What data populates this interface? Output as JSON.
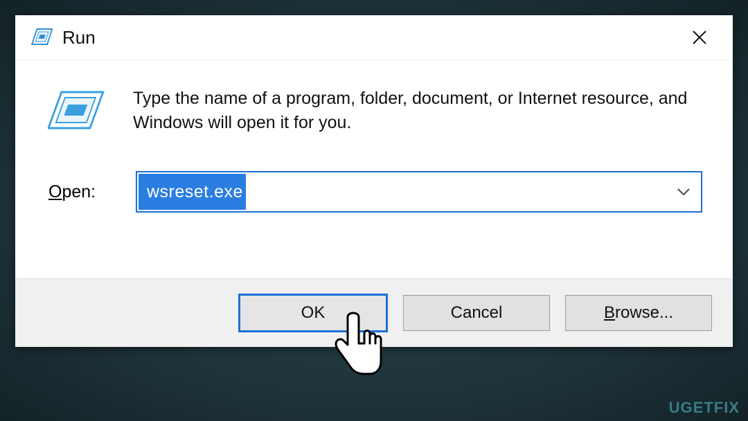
{
  "titlebar": {
    "title": "Run",
    "icon": "run-icon",
    "close_tooltip": "Close"
  },
  "body": {
    "run_glyph": "run-dialog-icon",
    "info_text": "Type the name of a program, folder, document, or Internet resource, and Windows will open it for you.",
    "open_label_pre": "O",
    "open_label_rest": "pen:",
    "input_value": "wsreset.exe"
  },
  "buttons": {
    "ok": "OK",
    "cancel": "Cancel",
    "browse_pre": "B",
    "browse_rest": "rowse..."
  },
  "watermark": "UGETFIX"
}
